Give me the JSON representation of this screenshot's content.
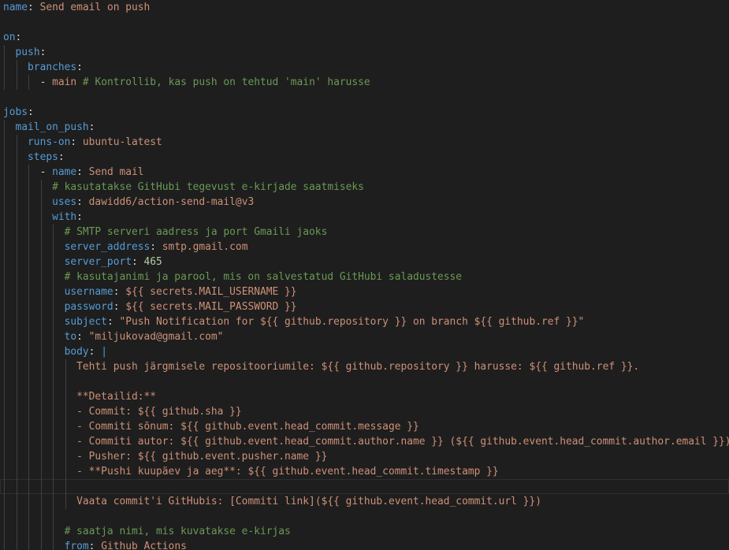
{
  "editor": {
    "language": "yaml",
    "theme": "dark",
    "colors": {
      "background": "#1e1e1e",
      "key": "#569cd6",
      "string": "#ce9178",
      "comment": "#6a9955",
      "number": "#b5cea8",
      "punctuation": "#d4d4d4",
      "indent_guide": "#404040"
    },
    "current_line": 32,
    "lines": [
      {
        "indent": 0,
        "tokens": [
          {
            "t": "k",
            "v": "name"
          },
          {
            "t": "p",
            "v": ": "
          },
          {
            "t": "s",
            "v": "Send email on push"
          }
        ]
      },
      {
        "indent": 0,
        "tokens": []
      },
      {
        "indent": 0,
        "tokens": [
          {
            "t": "k",
            "v": "on"
          },
          {
            "t": "p",
            "v": ":"
          }
        ]
      },
      {
        "indent": 2,
        "tokens": [
          {
            "t": "k",
            "v": "push"
          },
          {
            "t": "p",
            "v": ":"
          }
        ]
      },
      {
        "indent": 4,
        "tokens": [
          {
            "t": "k",
            "v": "branches"
          },
          {
            "t": "p",
            "v": ":"
          }
        ]
      },
      {
        "indent": 6,
        "tokens": [
          {
            "t": "p",
            "v": "- "
          },
          {
            "t": "s",
            "v": "main"
          },
          {
            "t": "c",
            "v": " # Kontrollib, kas push on tehtud 'main' harusse"
          }
        ]
      },
      {
        "indent": 0,
        "tokens": []
      },
      {
        "indent": 0,
        "tokens": [
          {
            "t": "k",
            "v": "jobs"
          },
          {
            "t": "p",
            "v": ":"
          }
        ]
      },
      {
        "indent": 2,
        "tokens": [
          {
            "t": "k",
            "v": "mail_on_push"
          },
          {
            "t": "p",
            "v": ":"
          }
        ]
      },
      {
        "indent": 4,
        "tokens": [
          {
            "t": "k",
            "v": "runs-on"
          },
          {
            "t": "p",
            "v": ": "
          },
          {
            "t": "s",
            "v": "ubuntu-latest"
          }
        ]
      },
      {
        "indent": 4,
        "tokens": [
          {
            "t": "k",
            "v": "steps"
          },
          {
            "t": "p",
            "v": ":"
          }
        ]
      },
      {
        "indent": 6,
        "tokens": [
          {
            "t": "p",
            "v": "- "
          },
          {
            "t": "k",
            "v": "name"
          },
          {
            "t": "p",
            "v": ": "
          },
          {
            "t": "s",
            "v": "Send mail"
          }
        ]
      },
      {
        "indent": 8,
        "tokens": [
          {
            "t": "c",
            "v": "# kasutatakse GitHubi tegevust e-kirjade saatmiseks"
          }
        ]
      },
      {
        "indent": 8,
        "tokens": [
          {
            "t": "k",
            "v": "uses"
          },
          {
            "t": "p",
            "v": ": "
          },
          {
            "t": "s",
            "v": "dawidd6/action-send-mail@v3"
          }
        ]
      },
      {
        "indent": 8,
        "tokens": [
          {
            "t": "k",
            "v": "with"
          },
          {
            "t": "p",
            "v": ":"
          }
        ]
      },
      {
        "indent": 10,
        "tokens": [
          {
            "t": "c",
            "v": "# SMTP serveri aadress ja port Gmaili jaoks"
          }
        ]
      },
      {
        "indent": 10,
        "tokens": [
          {
            "t": "k",
            "v": "server_address"
          },
          {
            "t": "p",
            "v": ": "
          },
          {
            "t": "s",
            "v": "smtp.gmail.com"
          }
        ]
      },
      {
        "indent": 10,
        "tokens": [
          {
            "t": "k",
            "v": "server_port"
          },
          {
            "t": "p",
            "v": ": "
          },
          {
            "t": "n",
            "v": "465"
          }
        ]
      },
      {
        "indent": 10,
        "tokens": [
          {
            "t": "c",
            "v": "# kasutajanimi ja parool, mis on salvestatud GitHubi saladustesse"
          }
        ]
      },
      {
        "indent": 10,
        "tokens": [
          {
            "t": "k",
            "v": "username"
          },
          {
            "t": "p",
            "v": ": "
          },
          {
            "t": "s",
            "v": "${{ secrets.MAIL_USERNAME }}"
          }
        ]
      },
      {
        "indent": 10,
        "tokens": [
          {
            "t": "k",
            "v": "password"
          },
          {
            "t": "p",
            "v": ": "
          },
          {
            "t": "s",
            "v": "${{ secrets.MAIL_PASSWORD }}"
          }
        ]
      },
      {
        "indent": 10,
        "tokens": [
          {
            "t": "k",
            "v": "subject"
          },
          {
            "t": "p",
            "v": ": "
          },
          {
            "t": "s",
            "v": "\"Push Notification for ${{ github.repository }} on branch ${{ github.ref }}\""
          }
        ]
      },
      {
        "indent": 10,
        "tokens": [
          {
            "t": "k",
            "v": "to"
          },
          {
            "t": "p",
            "v": ": "
          },
          {
            "t": "s",
            "v": "\"miljukovad@gmail.com\""
          }
        ]
      },
      {
        "indent": 10,
        "tokens": [
          {
            "t": "k",
            "v": "body"
          },
          {
            "t": "p",
            "v": ": "
          },
          {
            "t": "k",
            "v": "|"
          }
        ]
      },
      {
        "indent": 12,
        "tokens": [
          {
            "t": "s",
            "v": "Tehti push järgmisele repositooriumile: ${{ github.repository }} harusse: ${{ github.ref }}."
          }
        ]
      },
      {
        "indent": 12,
        "tokens": []
      },
      {
        "indent": 12,
        "tokens": [
          {
            "t": "s",
            "v": "**Detailid:**"
          }
        ]
      },
      {
        "indent": 12,
        "tokens": [
          {
            "t": "s",
            "v": "- Commit: ${{ github.sha }}"
          }
        ]
      },
      {
        "indent": 12,
        "tokens": [
          {
            "t": "s",
            "v": "- Commiti sõnum: ${{ github.event.head_commit.message }}"
          }
        ]
      },
      {
        "indent": 12,
        "tokens": [
          {
            "t": "s",
            "v": "- Commiti autor: ${{ github.event.head_commit.author.name }} (${{ github.event.head_commit.author.email }})"
          }
        ]
      },
      {
        "indent": 12,
        "tokens": [
          {
            "t": "s",
            "v": "- Pusher: ${{ github.event.pusher.name }}"
          }
        ]
      },
      {
        "indent": 12,
        "tokens": [
          {
            "t": "s",
            "v": "- **Pushi kuupäev ja aeg**: ${{ github.event.head_commit.timestamp }}"
          }
        ]
      },
      {
        "indent": 12,
        "tokens": []
      },
      {
        "indent": 12,
        "tokens": [
          {
            "t": "s",
            "v": "Vaata commit'i GitHubis: [Commiti link](${{ github.event.head_commit.url }})"
          }
        ]
      },
      {
        "indent": 10,
        "tokens": []
      },
      {
        "indent": 10,
        "tokens": [
          {
            "t": "c",
            "v": "# saatja nimi, mis kuvatakse e-kirjas"
          }
        ]
      },
      {
        "indent": 10,
        "tokens": [
          {
            "t": "k",
            "v": "from"
          },
          {
            "t": "p",
            "v": ": "
          },
          {
            "t": "s",
            "v": "Github Actions"
          }
        ]
      }
    ]
  }
}
